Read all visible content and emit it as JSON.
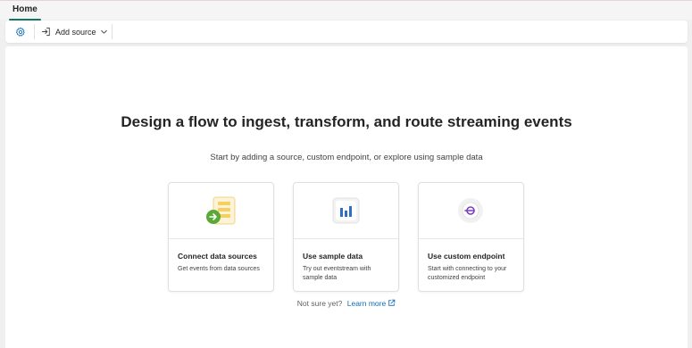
{
  "tabs": {
    "home": "Home"
  },
  "toolbar": {
    "add_source_label": "Add source"
  },
  "main": {
    "headline": "Design a flow to ingest, transform, and route streaming events",
    "subline": "Start by adding a source, custom endpoint, or explore using sample data",
    "cards": [
      {
        "title": "Connect data sources",
        "desc": "Get events from data sources"
      },
      {
        "title": "Use sample data",
        "desc": "Try out eventstream with sample data"
      },
      {
        "title": "Use custom endpoint",
        "desc": "Start with connecting to your customized endpoint"
      }
    ],
    "footer": {
      "prefix": "Not sure yet?",
      "link": "Learn more"
    }
  },
  "icons": {
    "settings": "gear-icon",
    "add_source": "sign-in-arrow-icon",
    "chevron": "chevron-down-icon",
    "external": "external-link-icon"
  },
  "colors": {
    "accent": "#117865",
    "link": "#0f6cbd",
    "settings_icon": "#0f6cbd"
  }
}
